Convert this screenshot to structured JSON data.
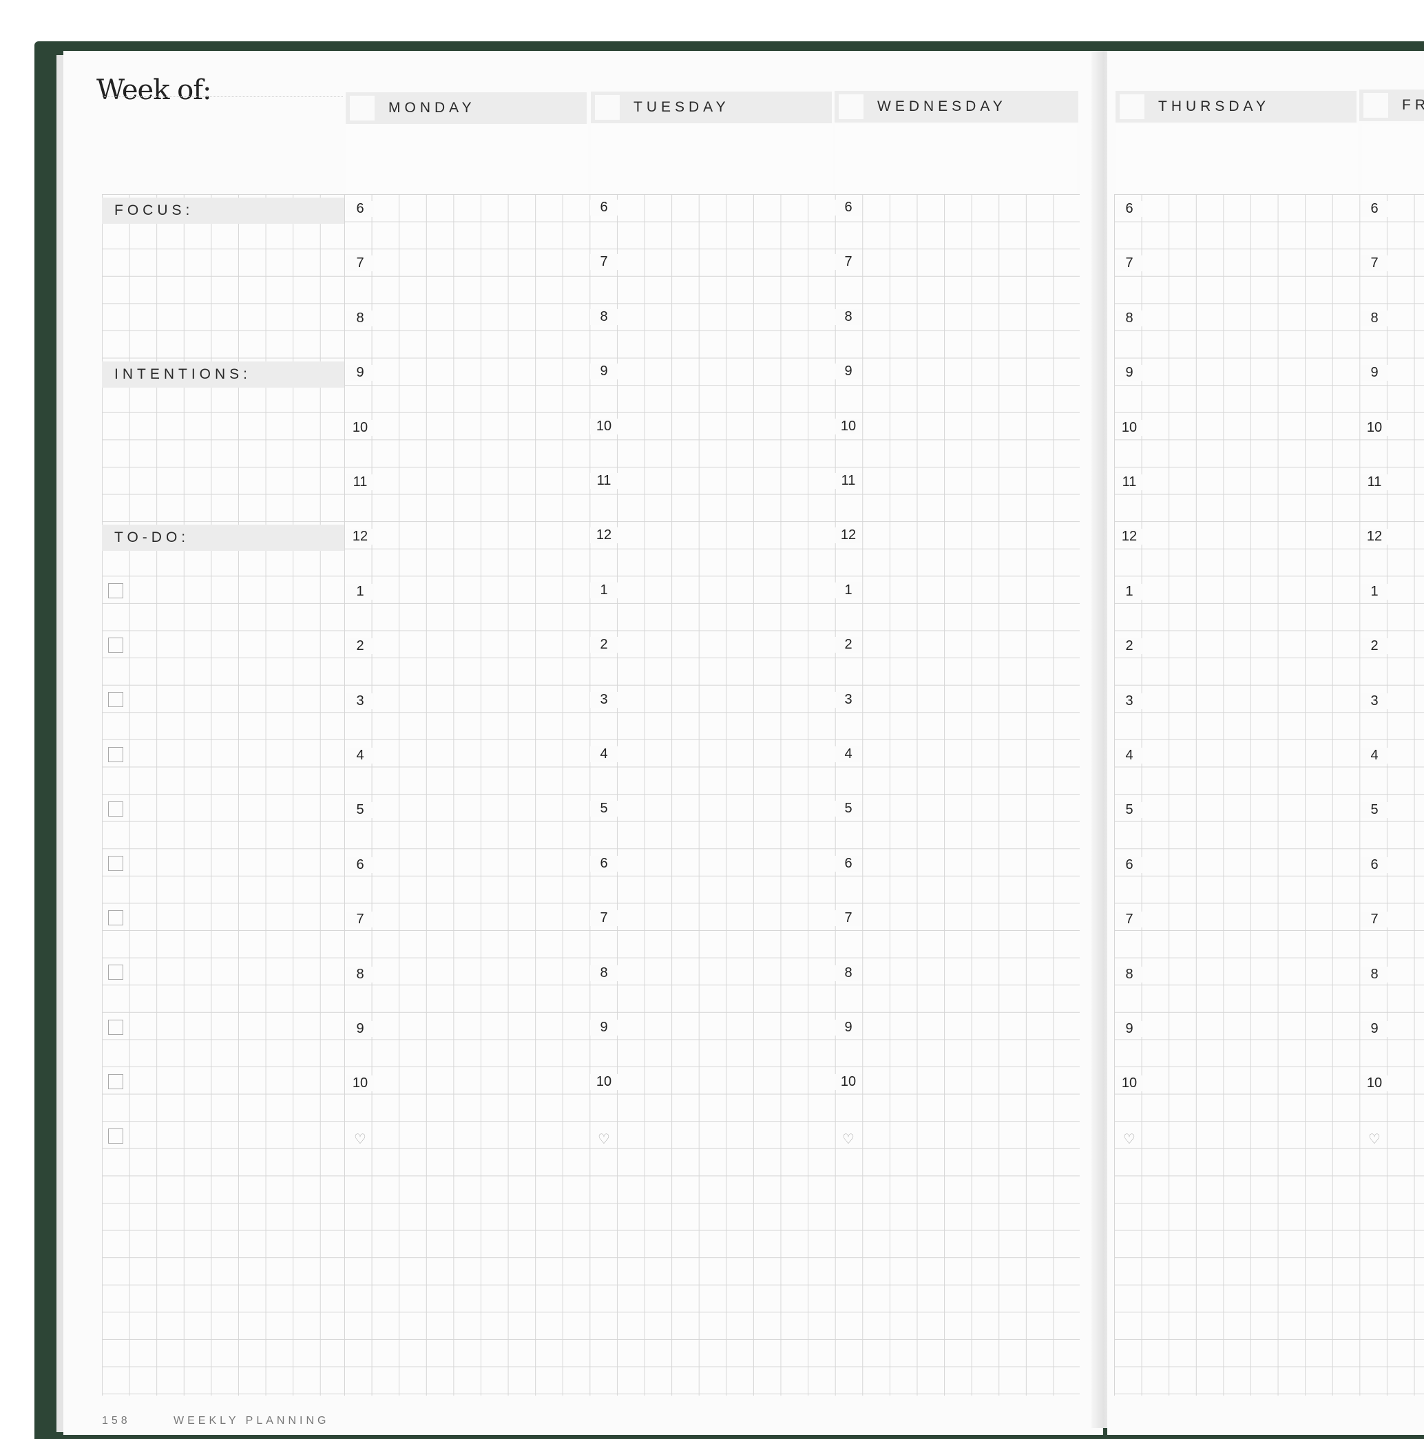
{
  "planner": {
    "week_of": "Week of:",
    "sections": {
      "focus": "FOCUS:",
      "intentions": "INTENTIONS:",
      "todo": "TO-DO:"
    },
    "days": [
      "MONDAY",
      "TUESDAY",
      "WEDNESDAY",
      "THURSDAY",
      "FR"
    ],
    "hours": [
      "6",
      "7",
      "8",
      "9",
      "10",
      "11",
      "12",
      "1",
      "2",
      "3",
      "4",
      "5",
      "6",
      "7",
      "8",
      "9",
      "10"
    ],
    "heart_symbol": "♡",
    "todo_checkbox_count": 11,
    "footer": {
      "page_number": "158",
      "section_title": "WEEKLY PLANNING"
    }
  },
  "colors": {
    "cover": "#2d4536",
    "band": "#ececec",
    "grid_line": "#d6d6d6"
  }
}
